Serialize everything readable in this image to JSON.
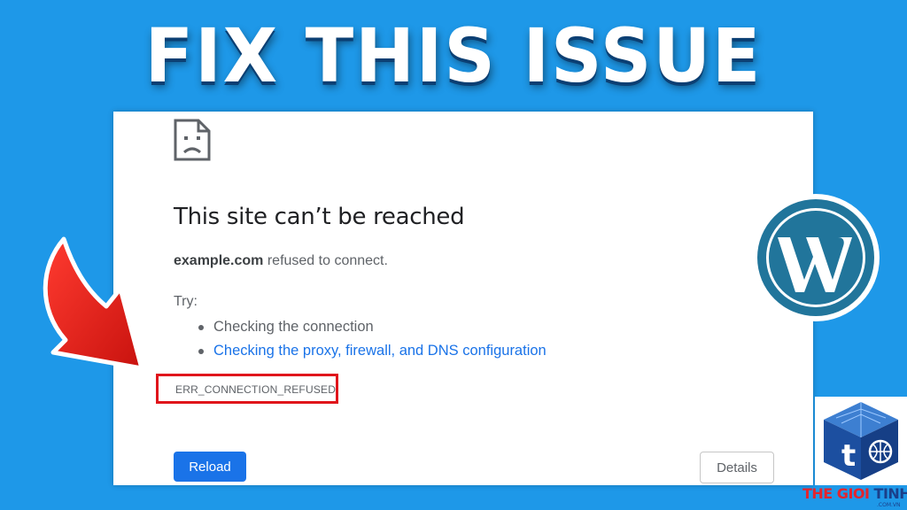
{
  "headline": "FIX THIS ISSUE",
  "error_page": {
    "icon": "sad-document-icon",
    "title": "This site can’t be reached",
    "domain": "example.com",
    "refused_text": " refused to connect.",
    "try_label": "Try:",
    "suggestions": [
      "Checking the connection",
      "Checking the proxy, firewall, and DNS configuration"
    ],
    "error_code": "ERR_CONNECTION_REFUSED",
    "reload_label": "Reload",
    "details_label": "Details"
  },
  "overlays": {
    "arrow_icon": "red-curved-arrow-icon",
    "wordpress_icon": "wordpress-logo-icon",
    "brand_icon": "tgth-cube-logo-icon",
    "brand_name_a": "THE GIOI",
    "brand_name_b": "TINHOC",
    "brand_domain": ".COM.VN"
  },
  "colors": {
    "background": "#1e98e8",
    "link": "#1a73e8",
    "highlight_box": "#e0151b",
    "wordpress": "#21759b",
    "arrow": "#e3201b"
  }
}
